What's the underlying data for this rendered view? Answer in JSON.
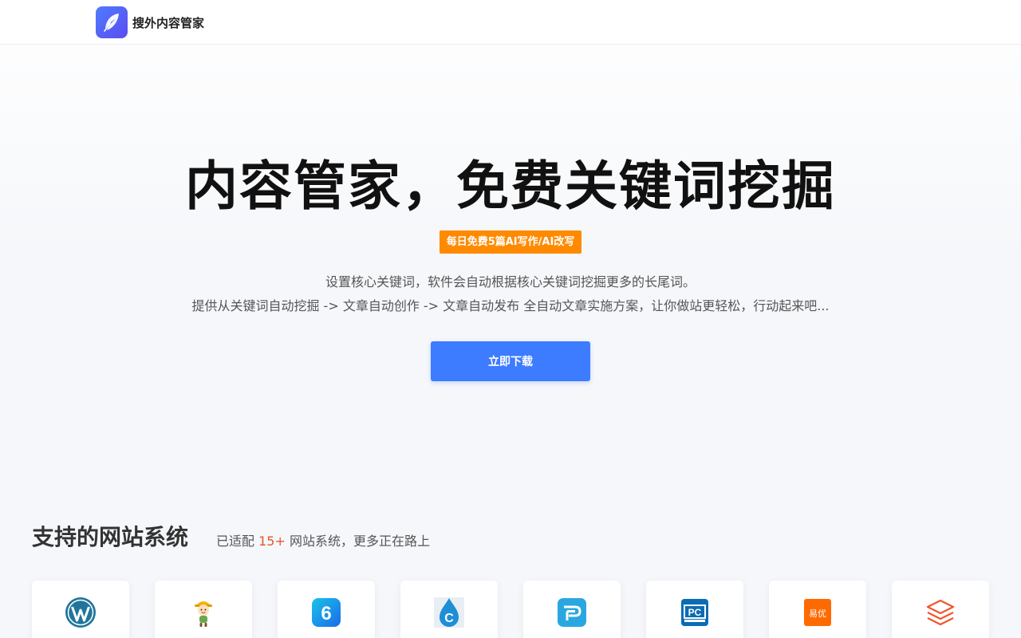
{
  "header": {
    "brand_name": "搜外内容管家",
    "logo_icon": "feather-icon",
    "brand_color": "#4f6af5"
  },
  "hero": {
    "title": "内容管家，免费关键词挖掘",
    "badge": "每日免费5篇AI写作/AI改写",
    "badge_color": "#ff8a00",
    "description_line1": "设置核心关键词，软件会自动根据核心关键词挖掘更多的长尾词。",
    "description_line2": "提供从关键词自动挖掘 -> 文章自动创作 -> 文章自动发布 全自动文章实施方案，让你做站更轻松，行动起来吧...",
    "download_label": "立即下载",
    "button_color": "#3d7bff"
  },
  "cms_section": {
    "title": "支持的网站系统",
    "subtitle_prefix": "已适配",
    "subtitle_count": "15+",
    "subtitle_suffix": "网站系统，更多正在路上",
    "count_color": "#e8552b",
    "items": [
      {
        "icon": "wordpress-icon"
      },
      {
        "icon": "mascot-icon"
      },
      {
        "icon": "six-logo-icon"
      },
      {
        "icon": "flame-c-icon"
      },
      {
        "icon": "p-logo-icon"
      },
      {
        "icon": "pc-logo-icon"
      },
      {
        "icon": "yiyou-icon",
        "label": "易优"
      },
      {
        "icon": "layers-icon"
      }
    ]
  }
}
